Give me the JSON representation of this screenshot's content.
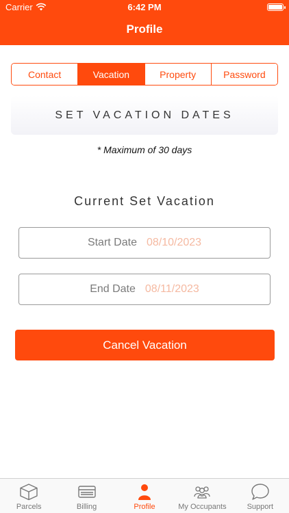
{
  "status_bar": {
    "carrier": "Carrier",
    "time": "6:42 PM"
  },
  "header": {
    "title": "Profile"
  },
  "tabs": [
    {
      "label": "Contact",
      "active": false
    },
    {
      "label": "Vacation",
      "active": true
    },
    {
      "label": "Property",
      "active": false
    },
    {
      "label": "Password",
      "active": false
    }
  ],
  "vacation": {
    "banner": "SET VACATION DATES",
    "max_note": "* Maximum of 30 days",
    "current_title": "Current Set Vacation",
    "start": {
      "label": "Start Date",
      "value": "08/10/2023"
    },
    "end": {
      "label": "End Date",
      "value": "08/11/2023"
    },
    "cancel_label": "Cancel Vacation"
  },
  "tabbar": {
    "items": [
      {
        "label": "Parcels",
        "icon": "package-icon"
      },
      {
        "label": "Billing",
        "icon": "credit-card-icon"
      },
      {
        "label": "Profile",
        "icon": "person-icon"
      },
      {
        "label": "My Occupants",
        "icon": "group-icon"
      },
      {
        "label": "Support",
        "icon": "chat-bubble-icon"
      }
    ],
    "active_index": 2
  },
  "colors": {
    "accent": "#ff4a0d",
    "date_value": "#f5b9a1",
    "tabbar_inactive": "#777777"
  }
}
